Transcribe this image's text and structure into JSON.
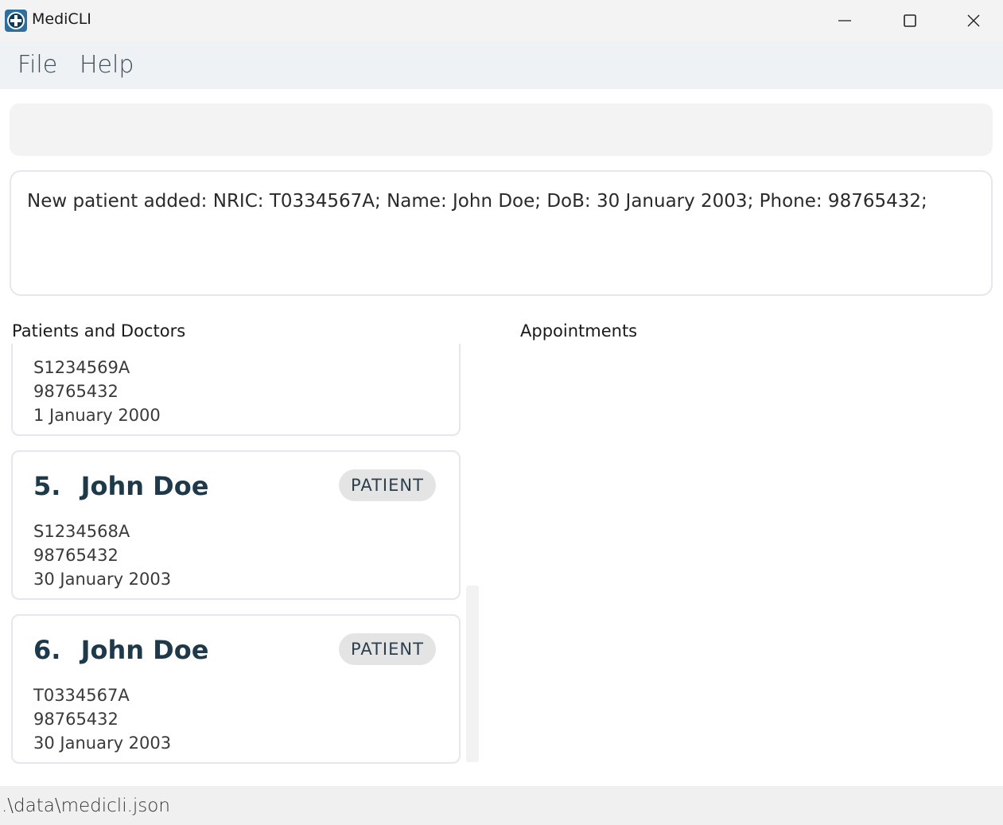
{
  "window": {
    "title": "MediCLI"
  },
  "menu": {
    "file": "File",
    "help": "Help"
  },
  "command": {
    "value": ""
  },
  "result": {
    "text": "New patient added: NRIC: T0334567A; Name: John Doe; DoB: 30 January 2003; Phone: 98765432;"
  },
  "panels": {
    "people_label": "Patients and Doctors",
    "appointments_label": "Appointments"
  },
  "cards": [
    {
      "nric": "S1234569A",
      "phone": "98765432",
      "dob": "1 January 2000"
    },
    {
      "index": "5.",
      "name": "John Doe",
      "role": "PATIENT",
      "nric": "S1234568A",
      "phone": "98765432",
      "dob": "30 January 2003"
    },
    {
      "index": "6.",
      "name": "John Doe",
      "role": "PATIENT",
      "nric": "T0334567A",
      "phone": "98765432",
      "dob": "30 January 2003"
    }
  ],
  "status": {
    "path": ".\\data\\medicli.json"
  },
  "icons": {
    "app": "medical-cross-icon",
    "minimize": "minimize-icon",
    "maximize": "maximize-icon",
    "close": "close-icon"
  },
  "colors": {
    "accent": "#1e3a4a",
    "badge_bg": "#e4e4e4",
    "menubar_bg": "#eef2f5"
  }
}
